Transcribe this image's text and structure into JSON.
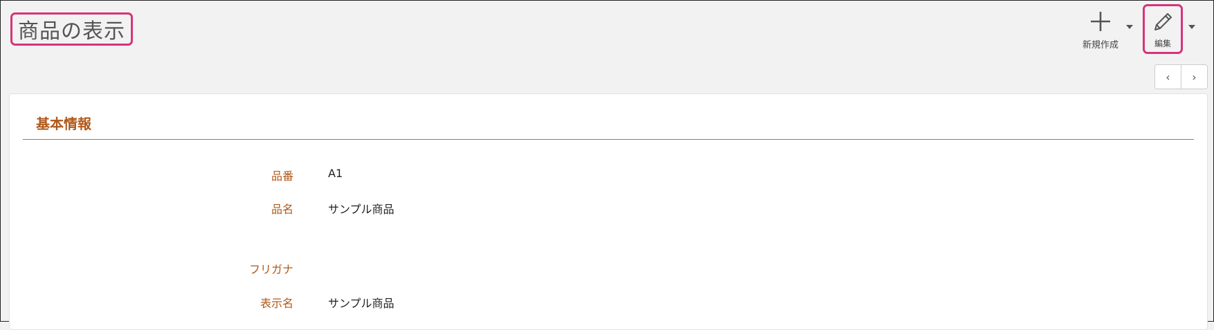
{
  "header": {
    "title": "商品の表示"
  },
  "toolbar": {
    "new_label": "新規作成",
    "edit_label": "編集"
  },
  "pager": {
    "prev": "‹",
    "next": "›"
  },
  "section": {
    "title": "基本情報",
    "fields": [
      {
        "label": "品番",
        "value": "A1"
      },
      {
        "label": "品名",
        "value": "サンプル商品"
      },
      {
        "label": "フリガナ",
        "value": ""
      },
      {
        "label": "表示名",
        "value": "サンプル商品"
      }
    ]
  },
  "colors": {
    "accent": "#b0581a",
    "highlight": "#d6337a",
    "background": "#f2f2f2"
  }
}
